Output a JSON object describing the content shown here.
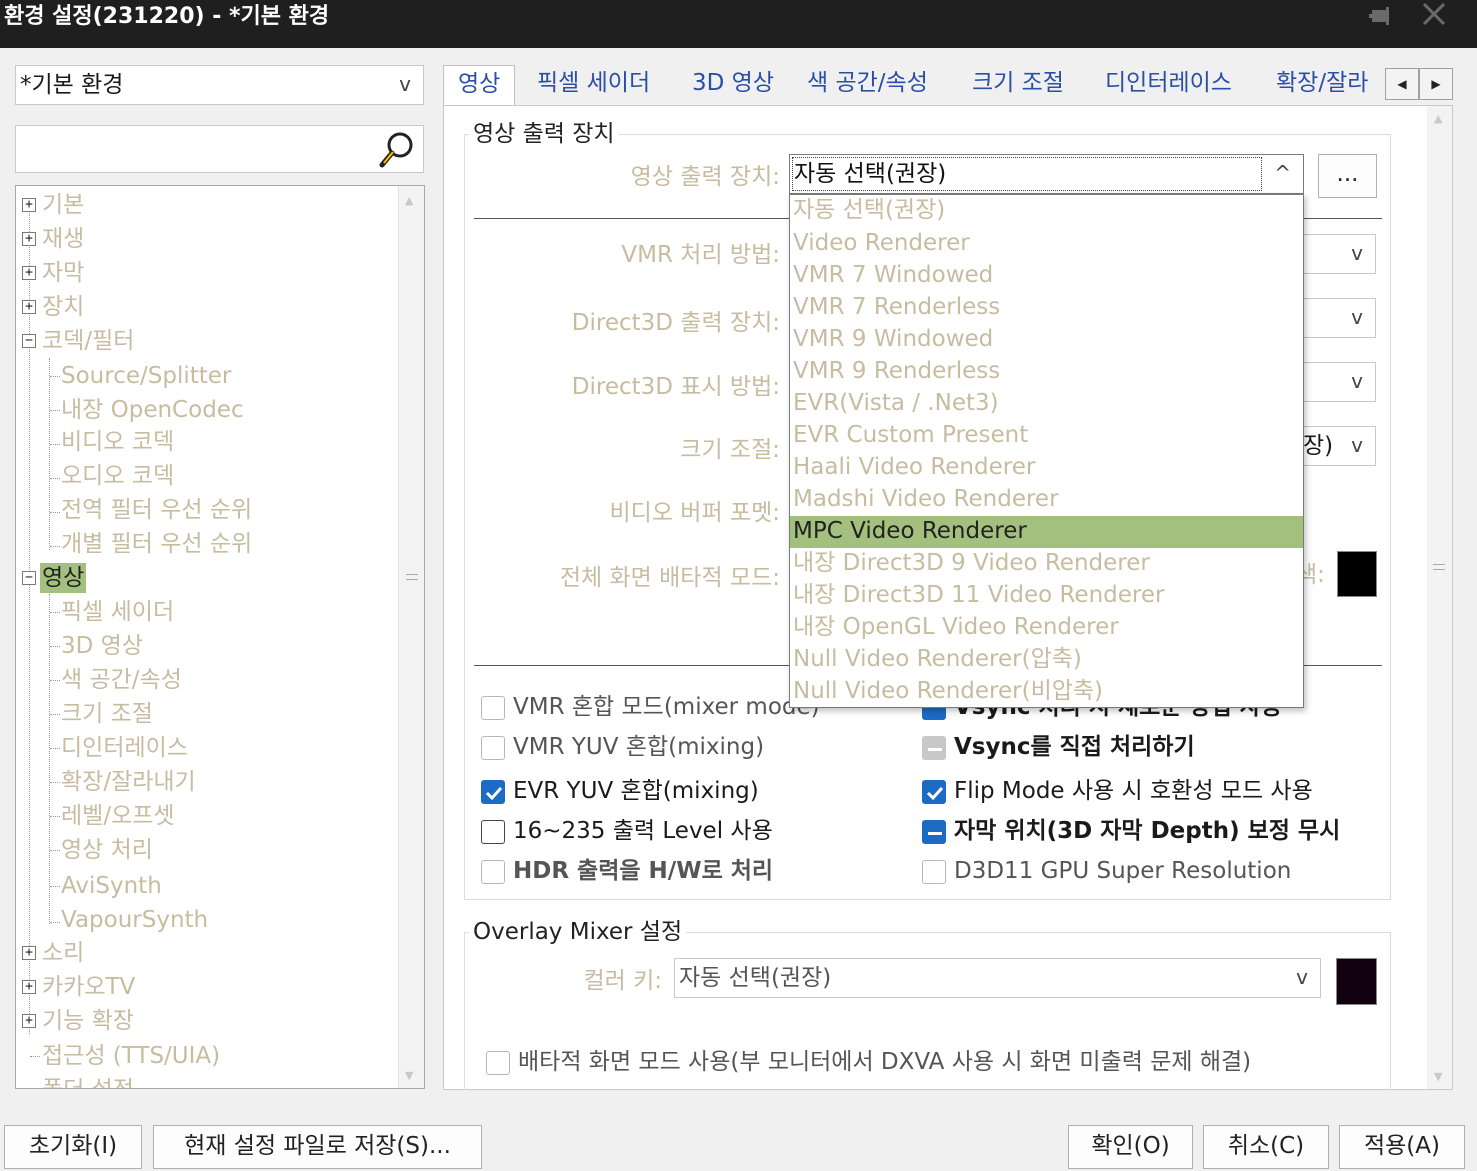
{
  "window": {
    "title": "환경 설정(231220) - *기본 환경",
    "pin_icon": "pin-icon",
    "close_icon": "close-icon"
  },
  "sidebar": {
    "profile": "*기본 환경",
    "search_value": "",
    "tree": [
      {
        "label": "기본",
        "expander": "+"
      },
      {
        "label": "재생",
        "expander": "+"
      },
      {
        "label": "자막",
        "expander": "+"
      },
      {
        "label": "장치",
        "expander": "+"
      },
      {
        "label": "코덱/필터",
        "expander": "−"
      },
      {
        "label": "Source/Splitter"
      },
      {
        "label": "내장 OpenCodec"
      },
      {
        "label": "비디오 코덱"
      },
      {
        "label": "오디오 코덱"
      },
      {
        "label": "전역 필터 우선 순위"
      },
      {
        "label": "개별 필터 우선 순위"
      },
      {
        "label": "영상",
        "expander": "−"
      },
      {
        "label": "픽셀 세이더"
      },
      {
        "label": "3D 영상"
      },
      {
        "label": "색 공간/속성"
      },
      {
        "label": "크기 조절"
      },
      {
        "label": "디인터레이스"
      },
      {
        "label": "확장/잘라내기"
      },
      {
        "label": "레벨/오프셋"
      },
      {
        "label": "영상 처리"
      },
      {
        "label": "AviSynth"
      },
      {
        "label": "VapourSynth"
      },
      {
        "label": "소리",
        "expander": "+"
      },
      {
        "label": "카카오TV",
        "expander": "+"
      },
      {
        "label": "기능 확장",
        "expander": "+"
      },
      {
        "label": "접근성 (TTS/UIA)"
      },
      {
        "label": "폴더 설정"
      }
    ]
  },
  "tabs": [
    "영상",
    "픽셀 세이더",
    "3D 영상",
    "색 공간/속성",
    "크기 조절",
    "디인터레이스",
    "확장/잘라"
  ],
  "tab_scroll": {
    "left": "◀",
    "right": "▶"
  },
  "output_group": {
    "title": "영상 출력 장치",
    "device_label": "영상 출력 장치:",
    "device_value": "자동 선택(권장)",
    "device_arrow": "^",
    "more_button": "...",
    "vmr_label": "VMR 처리 방법:",
    "d3d_device_label": "Direct3D 출력 장치:",
    "d3d_display_label": "Direct3D 표시 방법:",
    "resize_label": "크기 조절:",
    "resize_tail": "장)",
    "buffer_label": "비디오 버퍼 포멧:",
    "fullscreen_label": "전체 화면 배타적 모드:",
    "color_tail": "색:",
    "combo_arrow": "v"
  },
  "dropdown": {
    "options": [
      "자동 선택(권장)",
      "Video Renderer",
      "VMR 7 Windowed",
      "VMR 7 Renderless",
      "VMR 9 Windowed",
      "VMR 9 Renderless",
      "EVR(Vista / .Net3)",
      "EVR Custom Present",
      "Haali Video Renderer",
      "Madshi Video Renderer",
      "MPC Video Renderer",
      "내장 Direct3D 9 Video Renderer",
      "내장 Direct3D 11 Video Renderer",
      "내장 OpenGL Video Renderer",
      "Null Video Renderer(압축)",
      "Null Video Renderer(비압축)"
    ],
    "selected": "MPC Video Renderer"
  },
  "checkboxes": {
    "vmr_mixer": "VMR 혼합 모드(mixer mode)",
    "vmr_yuv": "VMR YUV 혼합(mixing)",
    "evr_yuv": "EVR YUV 혼합(mixing)",
    "level": "16~235 출력 Level 사용",
    "hdr": "HDR 출력을 H/W로 처리",
    "vsync_partial": "Vsync 처리 시 새로운 방법 사용",
    "vsync_direct": "Vsync를 직접 처리하기",
    "flip": "Flip Mode 사용 시 호환성 모드 사용",
    "subtitle": "자막 위치(3D 자막 Depth) 보정 무시",
    "d3d11": "D3D11 GPU Super Resolution"
  },
  "overlay_group": {
    "title": "Overlay Mixer 설정",
    "color_key_label": "컬러 키:",
    "color_key_value": "자동 선택(권장)",
    "combo_arrow": "v",
    "exclusive": "배타적 화면 모드 사용(부 모니터에서 DXVA 사용 시 화면 미출력 문제 해결)"
  },
  "footer": {
    "reset": "초기화(I)",
    "save": "현재 설정 파일로 저장(S)...",
    "ok": "확인(O)",
    "cancel": "취소(C)",
    "apply": "적용(A)"
  },
  "colors": {
    "selection": "#a4c07e",
    "disabled_text": "#c8bca0",
    "tab_text": "#2b4fa6",
    "checkbox_on": "#1c6bc5",
    "titlebar": "#1f1f1f"
  }
}
